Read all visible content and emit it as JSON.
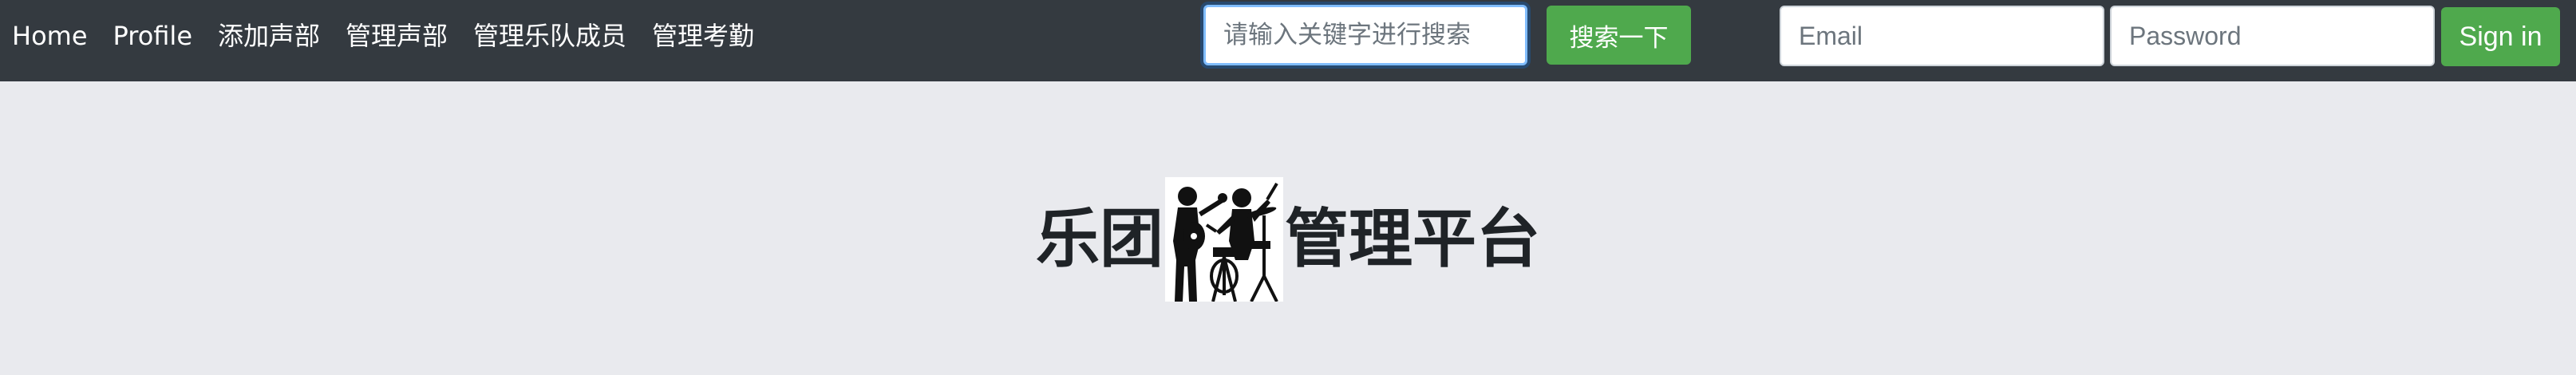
{
  "nav": {
    "items": [
      {
        "label": "Home"
      },
      {
        "label": "Profile"
      },
      {
        "label": "添加声部"
      },
      {
        "label": "管理声部"
      },
      {
        "label": "管理乐队成员"
      },
      {
        "label": "管理考勤"
      }
    ]
  },
  "search": {
    "placeholder": "请输入关键字进行搜索",
    "value": "",
    "button_label": "搜索一下"
  },
  "login": {
    "email_placeholder": "Email",
    "password_placeholder": "Password",
    "signin_label": "Sign in"
  },
  "hero": {
    "title_before": "乐团",
    "logo_icon": "band-musicians-icon",
    "title_after": "管理平台"
  },
  "colors": {
    "navbar_bg": "#343a40",
    "page_bg": "#e9eaee",
    "button_green": "#4fa94d",
    "focus_border": "#80bdff"
  }
}
